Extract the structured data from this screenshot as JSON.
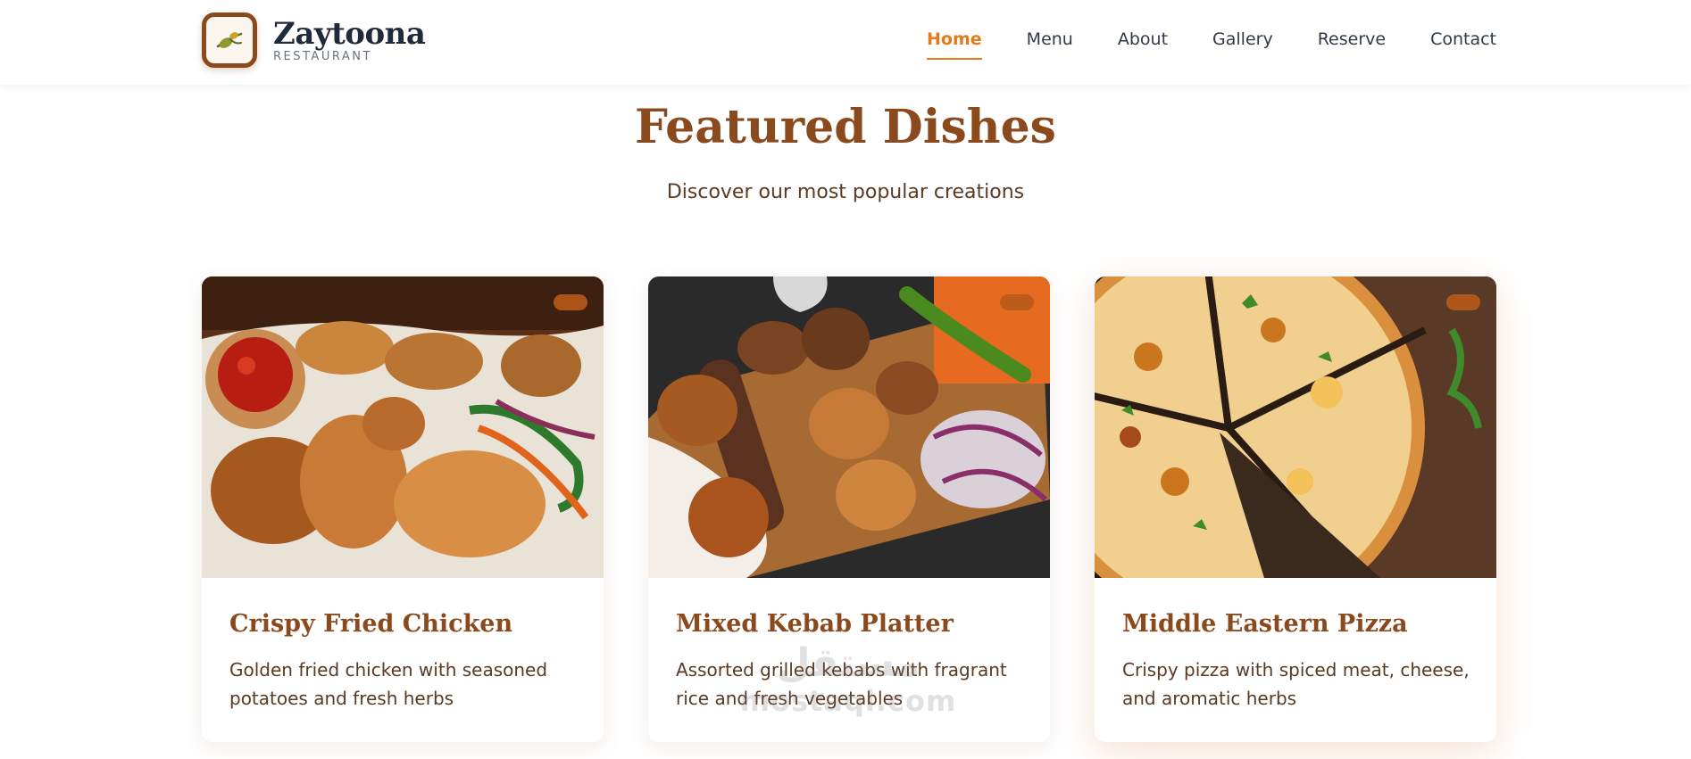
{
  "brand": {
    "name": "Zaytoona",
    "subtitle": "RESTAURANT",
    "icon": "olive-icon",
    "colors": {
      "primary": "#8a4a1d",
      "accent": "#e57a1a",
      "dark": "#1f2b3a"
    }
  },
  "nav": {
    "items": [
      {
        "label": "Home",
        "active": true
      },
      {
        "label": "Menu",
        "active": false
      },
      {
        "label": "About",
        "active": false
      },
      {
        "label": "Gallery",
        "active": false
      },
      {
        "label": "Reserve",
        "active": false
      },
      {
        "label": "Contact",
        "active": false
      }
    ]
  },
  "section": {
    "title": "Featured Dishes",
    "subtitle": "Discover our most popular creations"
  },
  "dishes": [
    {
      "title": "Crispy Fried Chicken",
      "description": "Golden fried chicken with seasoned potatoes and fresh herbs",
      "image": "fried-chicken-photo"
    },
    {
      "title": "Mixed Kebab Platter",
      "description": "Assorted grilled kebabs with fragrant rice and fresh vegetables",
      "image": "kebab-platter-photo"
    },
    {
      "title": "Middle Eastern Pizza",
      "description": "Crispy pizza with spiced meat, cheese, and aromatic herbs",
      "image": "pizza-photo"
    }
  ],
  "watermark": {
    "arabic": "مستقل",
    "latin": "mostaql.com"
  }
}
